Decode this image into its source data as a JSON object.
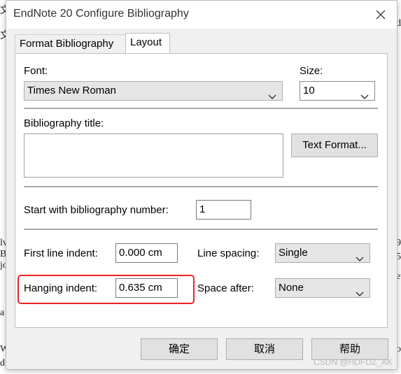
{
  "window": {
    "title": "EndNote 20 Configure Bibliography",
    "close_icon": "close-icon"
  },
  "tabs": [
    {
      "label": "Format Bibliography",
      "active": false
    },
    {
      "label": "Layout",
      "active": true
    }
  ],
  "font": {
    "label": "Font:",
    "value": "Times New Roman"
  },
  "size": {
    "label": "Size:",
    "value": "10"
  },
  "bibliography_title": {
    "label": "Bibliography title:",
    "value": ""
  },
  "text_format_button": "Text Format...",
  "start_number": {
    "label": "Start with bibliography number:",
    "value": "1"
  },
  "first_line_indent": {
    "label": "First line indent:",
    "value": "0.000 cm"
  },
  "line_spacing": {
    "label": "Line spacing:",
    "value": "Single"
  },
  "hanging_indent": {
    "label": "Hanging indent:",
    "value": "0.635 cm"
  },
  "space_after": {
    "label": "Space after:",
    "value": "None"
  },
  "buttons": {
    "ok": "确定",
    "cancel": "取消",
    "help": "帮助"
  },
  "highlight_color": "#ee2222",
  "watermark": "CSDN @HDFDZ_AK"
}
